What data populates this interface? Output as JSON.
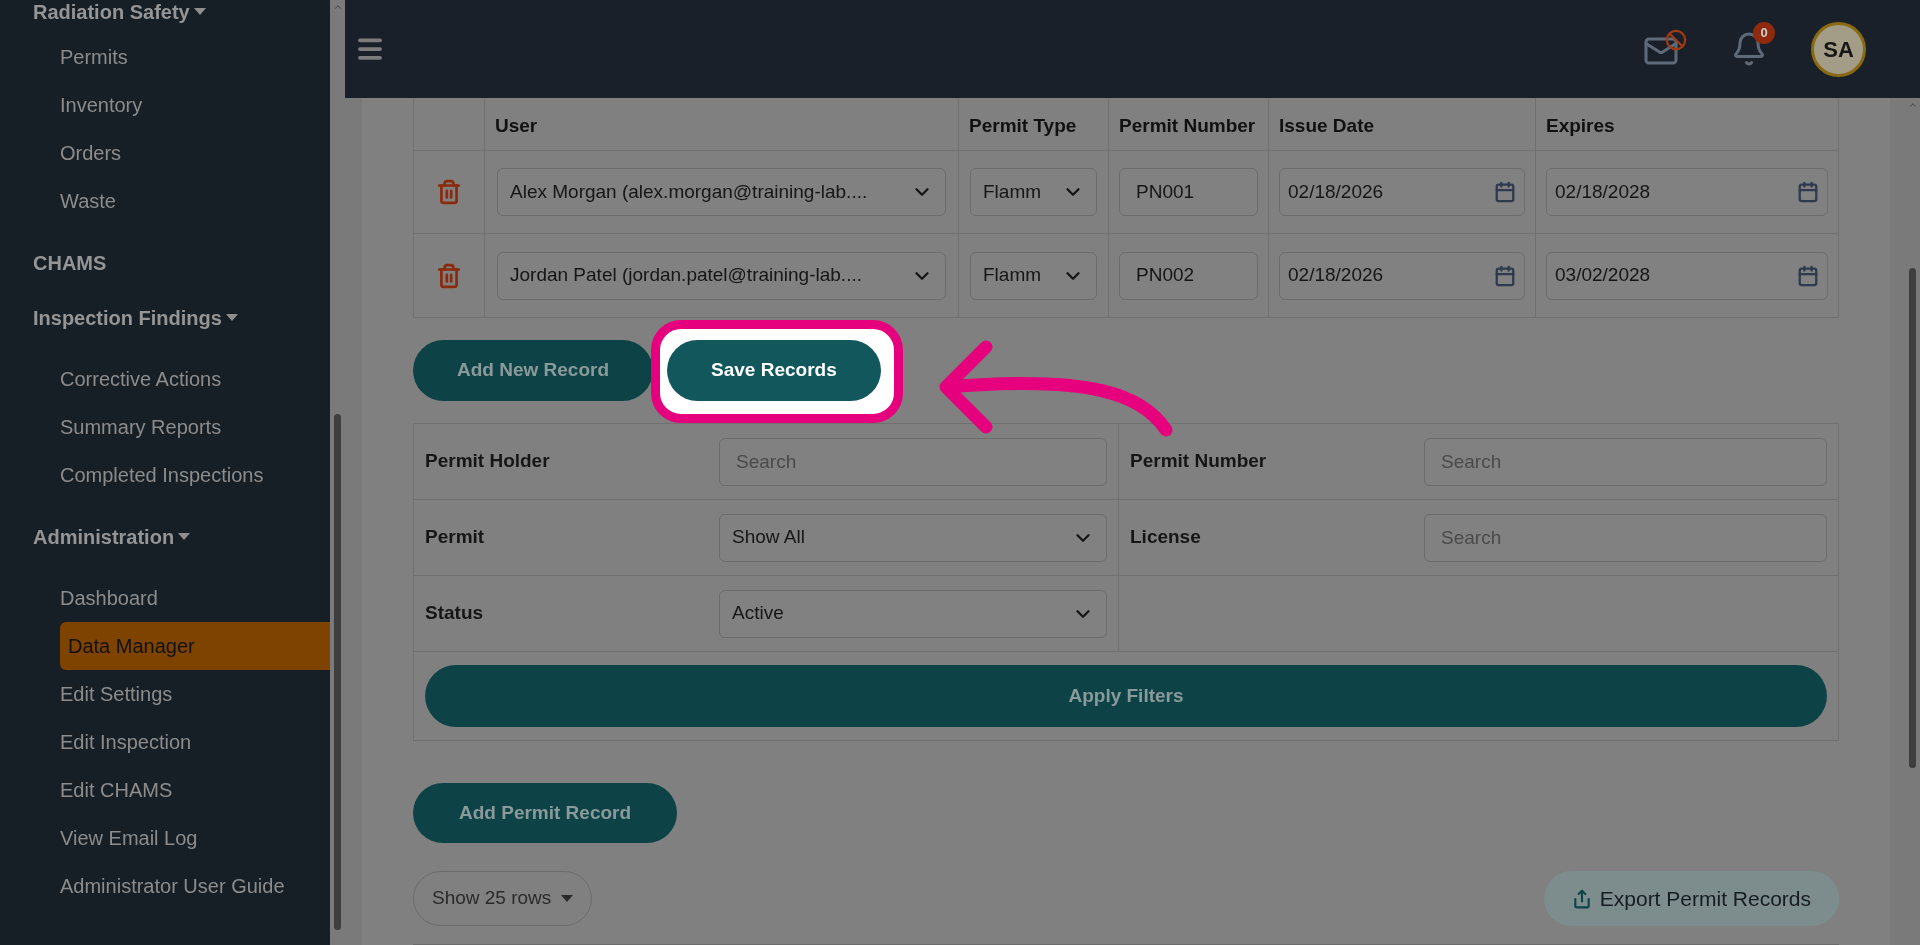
{
  "sidebar": {
    "groups": [
      {
        "title": "Radiation Safety",
        "collapsible": true,
        "items": [
          {
            "label": "Permits",
            "selected": false
          },
          {
            "label": "Inventory",
            "selected": false
          },
          {
            "label": "Orders",
            "selected": false
          },
          {
            "label": "Waste",
            "selected": false
          }
        ]
      },
      {
        "title": "CHAMS",
        "collapsible": false
      },
      {
        "title": "Inspection Findings",
        "collapsible": true,
        "items": [
          {
            "label": "Corrective Actions",
            "selected": false
          },
          {
            "label": "Summary Reports",
            "selected": false
          },
          {
            "label": "Completed Inspections",
            "selected": false
          }
        ]
      },
      {
        "title": "Administration",
        "collapsible": true,
        "items": [
          {
            "label": "Dashboard",
            "selected": false
          },
          {
            "label": "Data Manager",
            "selected": true
          },
          {
            "label": "Edit Settings",
            "selected": false
          },
          {
            "label": "Edit Inspection",
            "selected": false
          },
          {
            "label": "Edit CHAMS",
            "selected": false
          },
          {
            "label": "View Email Log",
            "selected": false
          },
          {
            "label": "Administrator User Guide",
            "selected": false
          }
        ]
      }
    ]
  },
  "header": {
    "notification_count": "0",
    "avatar_initials": "SA"
  },
  "records_table": {
    "columns": [
      "User",
      "Permit Type",
      "Permit Number",
      "Issue Date",
      "Expires"
    ],
    "rows": [
      {
        "user": "Alex Morgan (alex.morgan@training-lab....",
        "permit_type": "Flamm",
        "permit_number": "PN001",
        "issue_date": "02/18/2026",
        "expires": "02/18/2028"
      },
      {
        "user": "Jordan Patel (jordan.patel@training-lab....",
        "permit_type": "Flamm",
        "permit_number": "PN002",
        "issue_date": "02/18/2026",
        "expires": "03/02/2028"
      }
    ]
  },
  "record_buttons": [
    {
      "label": "Add New Record",
      "highlighted": false
    },
    {
      "label": "Save Records",
      "highlighted": true
    }
  ],
  "filters": [
    {
      "label": "Permit Holder",
      "kind": "search",
      "placeholder": "Search"
    },
    {
      "label": "Permit Number",
      "kind": "search",
      "placeholder": "Search"
    },
    {
      "label": "Permit",
      "kind": "select",
      "value": "Show All"
    },
    {
      "label": "License",
      "kind": "search",
      "placeholder": "Search"
    },
    {
      "label": "Status",
      "kind": "select",
      "value": "Active"
    }
  ],
  "apply_button": "Apply Filters",
  "add_permit_button": "Add Permit Record",
  "rows_select": "Show 25 rows",
  "export_button": "Export Permit Records"
}
